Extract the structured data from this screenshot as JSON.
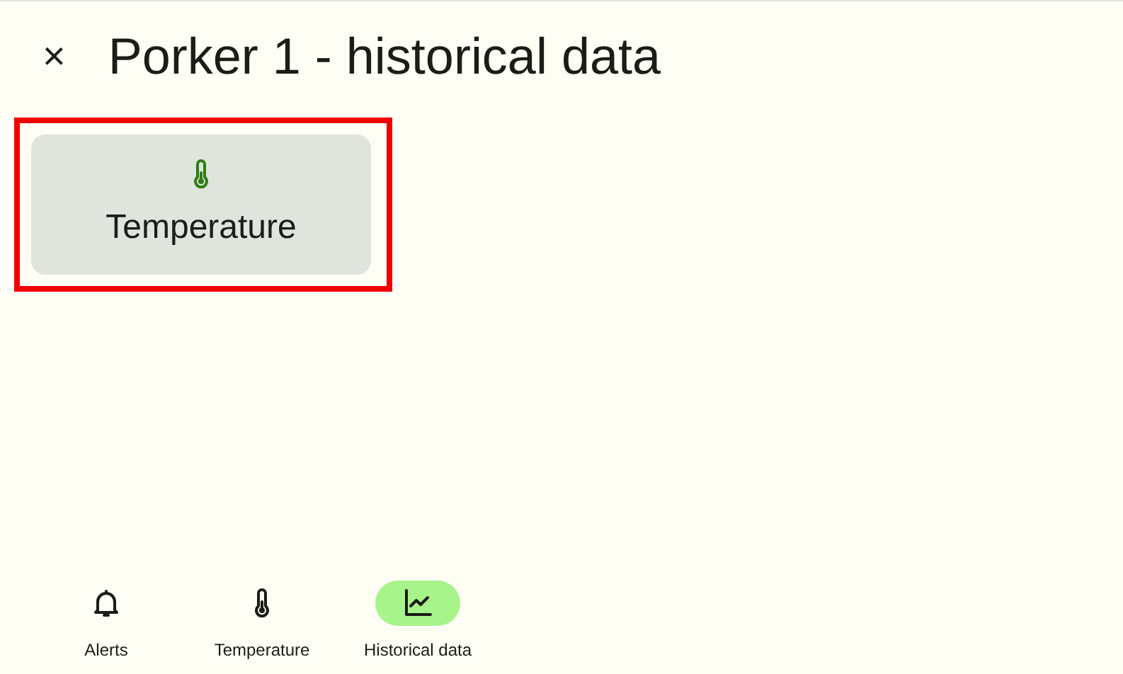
{
  "header": {
    "close": "×",
    "title": "Porker 1 - historical data"
  },
  "cards": [
    {
      "label": "Temperature",
      "kind": "thermometer",
      "highlighted": true
    }
  ],
  "nav": [
    {
      "label": "Alerts",
      "kind": "bell",
      "selected": false
    },
    {
      "label": "Temperature",
      "kind": "thermometer",
      "selected": false
    },
    {
      "label": "Historical data",
      "kind": "chart",
      "selected": true
    }
  ]
}
